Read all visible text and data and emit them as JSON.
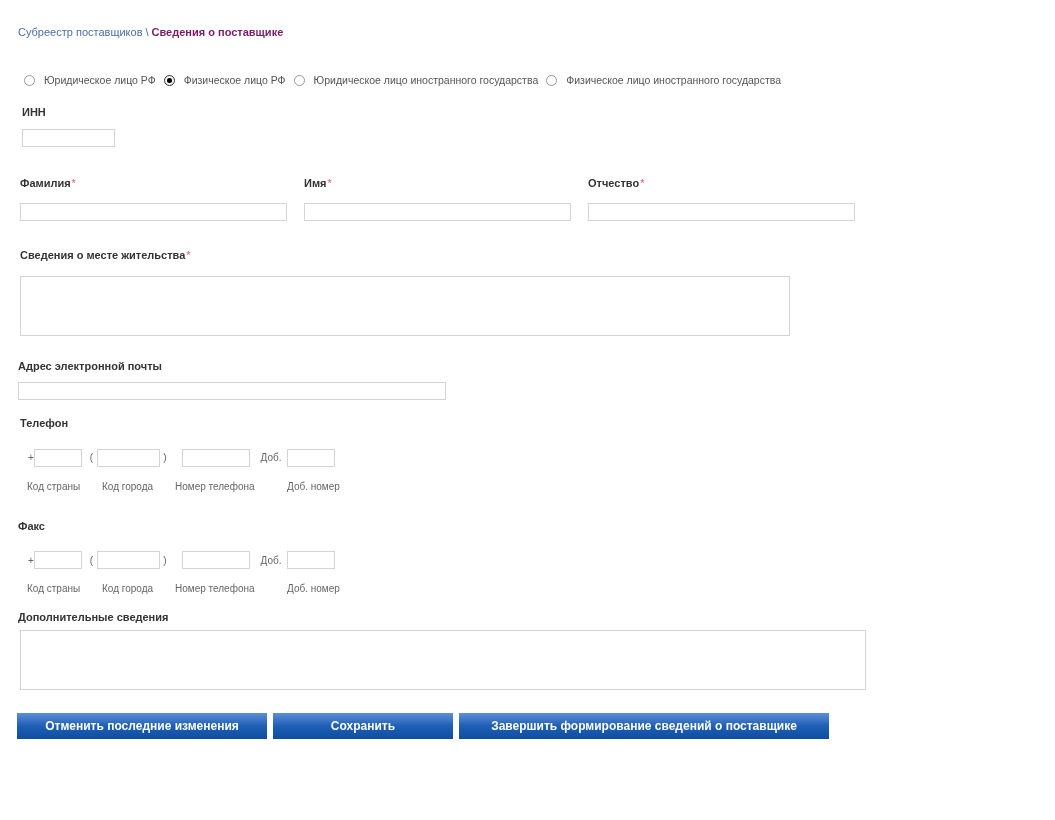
{
  "breadcrumb": {
    "parent": "Субреестр поставщиков",
    "separator": "\\",
    "current": "Сведения о поставщике"
  },
  "entity_types": [
    {
      "label": "Юридическое лицо РФ",
      "selected": false
    },
    {
      "label": "Физическое лицо РФ",
      "selected": true
    },
    {
      "label": "Юридическое лицо иностранного государства",
      "selected": false
    },
    {
      "label": "Физическое лицо иностранного государства",
      "selected": false
    }
  ],
  "inn": {
    "label": "ИНН"
  },
  "name_fields": [
    {
      "label": "Фамилия",
      "required_mark": "*"
    },
    {
      "label": "Имя",
      "required_mark": "*"
    },
    {
      "label": "Отчество",
      "required_mark": "*"
    }
  ],
  "residence": {
    "label": "Сведения о месте жительства",
    "required_mark": "*"
  },
  "email": {
    "label": "Адрес электронной почты"
  },
  "phones": [
    {
      "label": "Телефон",
      "plus": "+",
      "open": "(",
      "close": ")",
      "ext": "Доб.",
      "captions": [
        "Код страны",
        "Код города",
        "Номер телефона",
        "Доб. номер"
      ]
    },
    {
      "label": "Факс",
      "plus": "+",
      "open": "(",
      "close": ")",
      "ext": "Доб.",
      "captions": [
        "Код страны",
        "Код города",
        "Номер телефона",
        "Доб. номер"
      ]
    }
  ],
  "extra": {
    "label": "Дополнительные сведения"
  },
  "buttons": [
    "Отменить последние изменения",
    "Сохранить",
    "Завершить формирование сведений о поставщике"
  ]
}
